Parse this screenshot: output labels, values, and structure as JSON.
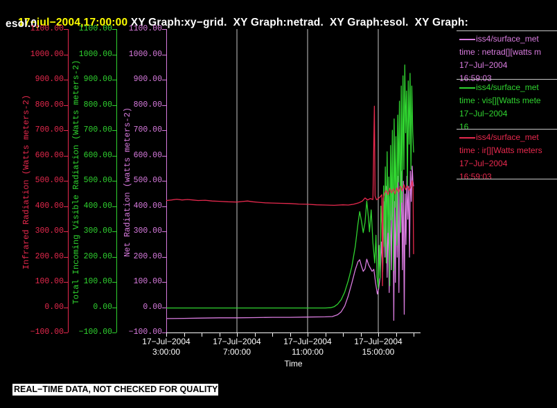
{
  "window": {
    "timestamp": "17−jul−2004,17:00:00",
    "title": " XY Graph:xy−grid.  XY Graph:netrad.  XY Graph:esol.  XY Graph:",
    "title_line2": "esol.0."
  },
  "status_bar": {
    "text": "REAL−TIME DATA, NOT CHECKED FOR QUALITY"
  },
  "colors": {
    "background": "#000000",
    "axis_white": "#ffffff",
    "gridline": "#c9c9c9",
    "timestamp_yellow": "#ffff00",
    "ir_red": "#e8294e",
    "vis_green": "#30d430",
    "net_magenta": "#da7ce0"
  },
  "legend": {
    "separator_color": "#c9c9c9",
    "entries": [
      {
        "series": "netrad",
        "color": "#da7ce0",
        "name": "iss4/surface_met",
        "lines": [
          "time : netrad[][watts m",
          "17−Jul−2004",
          "16:59:03"
        ]
      },
      {
        "series": "vis",
        "color": "#30d430",
        "name": "iss4/surface_met",
        "lines": [
          "time : vis[][Watts mete",
          "17−Jul−2004",
          "16"
        ]
      },
      {
        "series": "ir",
        "color": "#e8294e",
        "name": "iss4/surface_met",
        "lines": [
          "time : ir[][Watts meters",
          "17−Jul−2004",
          "16:59:03"
        ]
      }
    ]
  },
  "chart_data": {
    "type": "line",
    "x_axis": {
      "label": "Time",
      "start_hour": 3,
      "end_hour": 17,
      "minor_tick_every_hours": 1,
      "major_ticks": [
        {
          "hour": 3,
          "date": "17−Jul−2004",
          "time": "3:00:00"
        },
        {
          "hour": 7,
          "date": "17−Jul−2004",
          "time": "7:00:00"
        },
        {
          "hour": 11,
          "date": "17−Jul−2004",
          "time": "11:00:00"
        },
        {
          "hour": 15,
          "date": "17−Jul−2004",
          "time": "15:00:00"
        }
      ],
      "gridline_hours": [
        7,
        11,
        15
      ]
    },
    "y_axes": [
      {
        "id": "ir",
        "label": "Infrared Radiation (Watts meters-2)",
        "color": "#e8294e",
        "min": -100,
        "max": 1100,
        "tick_step": 100,
        "tick_format": "0.00"
      },
      {
        "id": "vis",
        "label": "Total Incoming Visible Radiation (Watts meters-2)",
        "color": "#30d430",
        "min": -100,
        "max": 1100,
        "tick_step": 100,
        "tick_format": "0.00"
      },
      {
        "id": "net",
        "label": "Net Radiation (watts meters-2)",
        "color": "#da7ce0",
        "min": -100,
        "max": 1100,
        "tick_step": 100,
        "tick_format": "0.00"
      }
    ],
    "series": [
      {
        "name": "netrad",
        "color": "#da7ce0",
        "points": [
          [
            3,
            -45
          ],
          [
            4,
            -44
          ],
          [
            5,
            -43
          ],
          [
            6,
            -42
          ],
          [
            7,
            -42
          ],
          [
            8,
            -41
          ],
          [
            9,
            -40
          ],
          [
            10,
            -40
          ],
          [
            11,
            -39
          ],
          [
            12,
            -38
          ],
          [
            12.4,
            -37
          ],
          [
            12.7,
            -30
          ],
          [
            12.9,
            -18
          ],
          [
            13.1,
            5
          ],
          [
            13.3,
            45
          ],
          [
            13.5,
            95
          ],
          [
            13.7,
            148
          ],
          [
            13.85,
            180
          ],
          [
            13.95,
            188
          ],
          [
            14.05,
            162
          ],
          [
            14.15,
            142
          ],
          [
            14.25,
            152
          ],
          [
            14.35,
            190
          ],
          [
            14.45,
            168
          ],
          [
            14.55,
            155
          ],
          [
            14.65,
            142
          ],
          [
            14.75,
            150
          ],
          [
            14.85,
            95
          ],
          [
            14.95,
            52
          ],
          [
            15.02,
            72
          ],
          [
            15.1,
            118
          ],
          [
            15.18,
            258
          ],
          [
            15.25,
            148
          ],
          [
            15.32,
            418
          ],
          [
            15.38,
            198
          ],
          [
            15.44,
            478
          ],
          [
            15.5,
            118
          ],
          [
            15.56,
            378
          ],
          [
            15.62,
            58
          ],
          [
            15.68,
            438
          ],
          [
            15.74,
            148
          ],
          [
            15.8,
            498
          ],
          [
            15.85,
            248
          ],
          [
            15.88,
            -52
          ],
          [
            15.92,
            418
          ],
          [
            15.97,
            98
          ],
          [
            16.02,
            478
          ],
          [
            16.07,
            198
          ],
          [
            16.12,
            518
          ],
          [
            16.17,
            58
          ],
          [
            16.22,
            478
          ],
          [
            16.27,
            298
          ],
          [
            16.32,
            538
          ],
          [
            16.37,
            148
          ],
          [
            16.42,
            498
          ],
          [
            16.47,
            -28
          ],
          [
            16.52,
            448
          ],
          [
            16.57,
            248
          ],
          [
            16.62,
            518
          ],
          [
            16.67,
            348
          ],
          [
            16.72,
            478
          ],
          [
            16.77,
            198
          ],
          [
            16.82,
            538
          ],
          [
            16.87,
            418
          ],
          [
            16.92,
            558
          ],
          [
            16.96,
            498
          ],
          [
            17,
            478
          ]
        ]
      },
      {
        "name": "vis",
        "color": "#30d430",
        "points": [
          [
            3,
            -3
          ],
          [
            4,
            -3
          ],
          [
            5,
            -3
          ],
          [
            6,
            -3
          ],
          [
            7,
            -3
          ],
          [
            8,
            -3
          ],
          [
            9,
            -3
          ],
          [
            10,
            -3
          ],
          [
            11,
            -3
          ],
          [
            12,
            -3
          ],
          [
            12.3,
            -2
          ],
          [
            12.5,
            2
          ],
          [
            12.7,
            12
          ],
          [
            12.9,
            30
          ],
          [
            13.1,
            60
          ],
          [
            13.3,
            105
          ],
          [
            13.5,
            160
          ],
          [
            13.7,
            240
          ],
          [
            13.85,
            330
          ],
          [
            13.95,
            378
          ],
          [
            14.05,
            340
          ],
          [
            14.15,
            295
          ],
          [
            14.25,
            335
          ],
          [
            14.35,
            420
          ],
          [
            14.45,
            350
          ],
          [
            14.5,
            298
          ],
          [
            14.6,
            385
          ],
          [
            14.7,
            255
          ],
          [
            14.8,
            175
          ],
          [
            14.87,
            285
          ],
          [
            14.93,
            120
          ],
          [
            15,
            75
          ],
          [
            15.05,
            245
          ],
          [
            15.1,
            115
          ],
          [
            15.15,
            400
          ],
          [
            15.2,
            330
          ],
          [
            15.25,
            140
          ],
          [
            15.3,
            480
          ],
          [
            15.35,
            240
          ],
          [
            15.4,
            555
          ],
          [
            15.45,
            175
          ],
          [
            15.5,
            615
          ],
          [
            15.55,
            295
          ],
          [
            15.6,
            515
          ],
          [
            15.65,
            85
          ],
          [
            15.7,
            640
          ],
          [
            15.75,
            345
          ],
          [
            15.8,
            700
          ],
          [
            15.85,
            145
          ],
          [
            15.9,
            745
          ],
          [
            15.95,
            395
          ],
          [
            16,
            675
          ],
          [
            16.05,
            245
          ],
          [
            16.1,
            760
          ],
          [
            16.15,
            495
          ],
          [
            16.2,
            815
          ],
          [
            16.25,
            295
          ],
          [
            16.3,
            875
          ],
          [
            16.35,
            415
          ],
          [
            16.4,
            915
          ],
          [
            16.45,
            545
          ],
          [
            16.5,
            958
          ],
          [
            16.55,
            690
          ],
          [
            16.6,
            855
          ],
          [
            16.65,
            475
          ],
          [
            16.7,
            895
          ],
          [
            16.75,
            645
          ],
          [
            16.8,
            925
          ],
          [
            16.85,
            545
          ],
          [
            16.9,
            875
          ],
          [
            16.95,
            695
          ],
          [
            17,
            612
          ]
        ]
      },
      {
        "name": "ir",
        "color": "#e8294e",
        "points": [
          [
            3,
            422
          ],
          [
            3.3,
            424
          ],
          [
            3.6,
            427
          ],
          [
            3.9,
            424
          ],
          [
            4.2,
            426
          ],
          [
            4.5,
            424
          ],
          [
            4.8,
            422
          ],
          [
            5.2,
            423
          ],
          [
            5.6,
            420
          ],
          [
            6,
            419
          ],
          [
            6.5,
            417
          ],
          [
            7,
            416
          ],
          [
            7.3,
            418
          ],
          [
            7.6,
            420
          ],
          [
            7.9,
            417
          ],
          [
            8.2,
            415
          ],
          [
            8.6,
            413
          ],
          [
            9,
            412
          ],
          [
            9.5,
            411
          ],
          [
            10,
            410
          ],
          [
            10.5,
            408
          ],
          [
            11,
            407
          ],
          [
            11.5,
            405
          ],
          [
            12,
            404
          ],
          [
            12.5,
            403
          ],
          [
            13,
            405
          ],
          [
            13.3,
            404
          ],
          [
            13.6,
            407
          ],
          [
            13.9,
            413
          ],
          [
            14.1,
            420
          ],
          [
            14.25,
            432
          ],
          [
            14.4,
            424
          ],
          [
            14.55,
            430
          ],
          [
            14.7,
            426
          ],
          [
            14.78,
            795
          ],
          [
            14.82,
            440
          ],
          [
            14.9,
            425
          ],
          [
            15,
            430
          ],
          [
            15.1,
            436
          ],
          [
            15.2,
            445
          ],
          [
            15.24,
            85
          ],
          [
            15.28,
            430
          ],
          [
            15.35,
            450
          ],
          [
            15.45,
            462
          ],
          [
            15.55,
            445
          ],
          [
            15.65,
            470
          ],
          [
            15.75,
            452
          ],
          [
            15.85,
            468
          ],
          [
            15.95,
            448
          ],
          [
            16.05,
            472
          ],
          [
            16.15,
            455
          ],
          [
            16.25,
            478
          ],
          [
            16.35,
            460
          ],
          [
            16.45,
            485
          ],
          [
            16.55,
            465
          ],
          [
            16.65,
            480
          ],
          [
            16.75,
            462
          ],
          [
            16.85,
            478
          ],
          [
            16.92,
            500
          ],
          [
            16.97,
            470
          ],
          [
            17,
            210
          ]
        ]
      }
    ]
  }
}
